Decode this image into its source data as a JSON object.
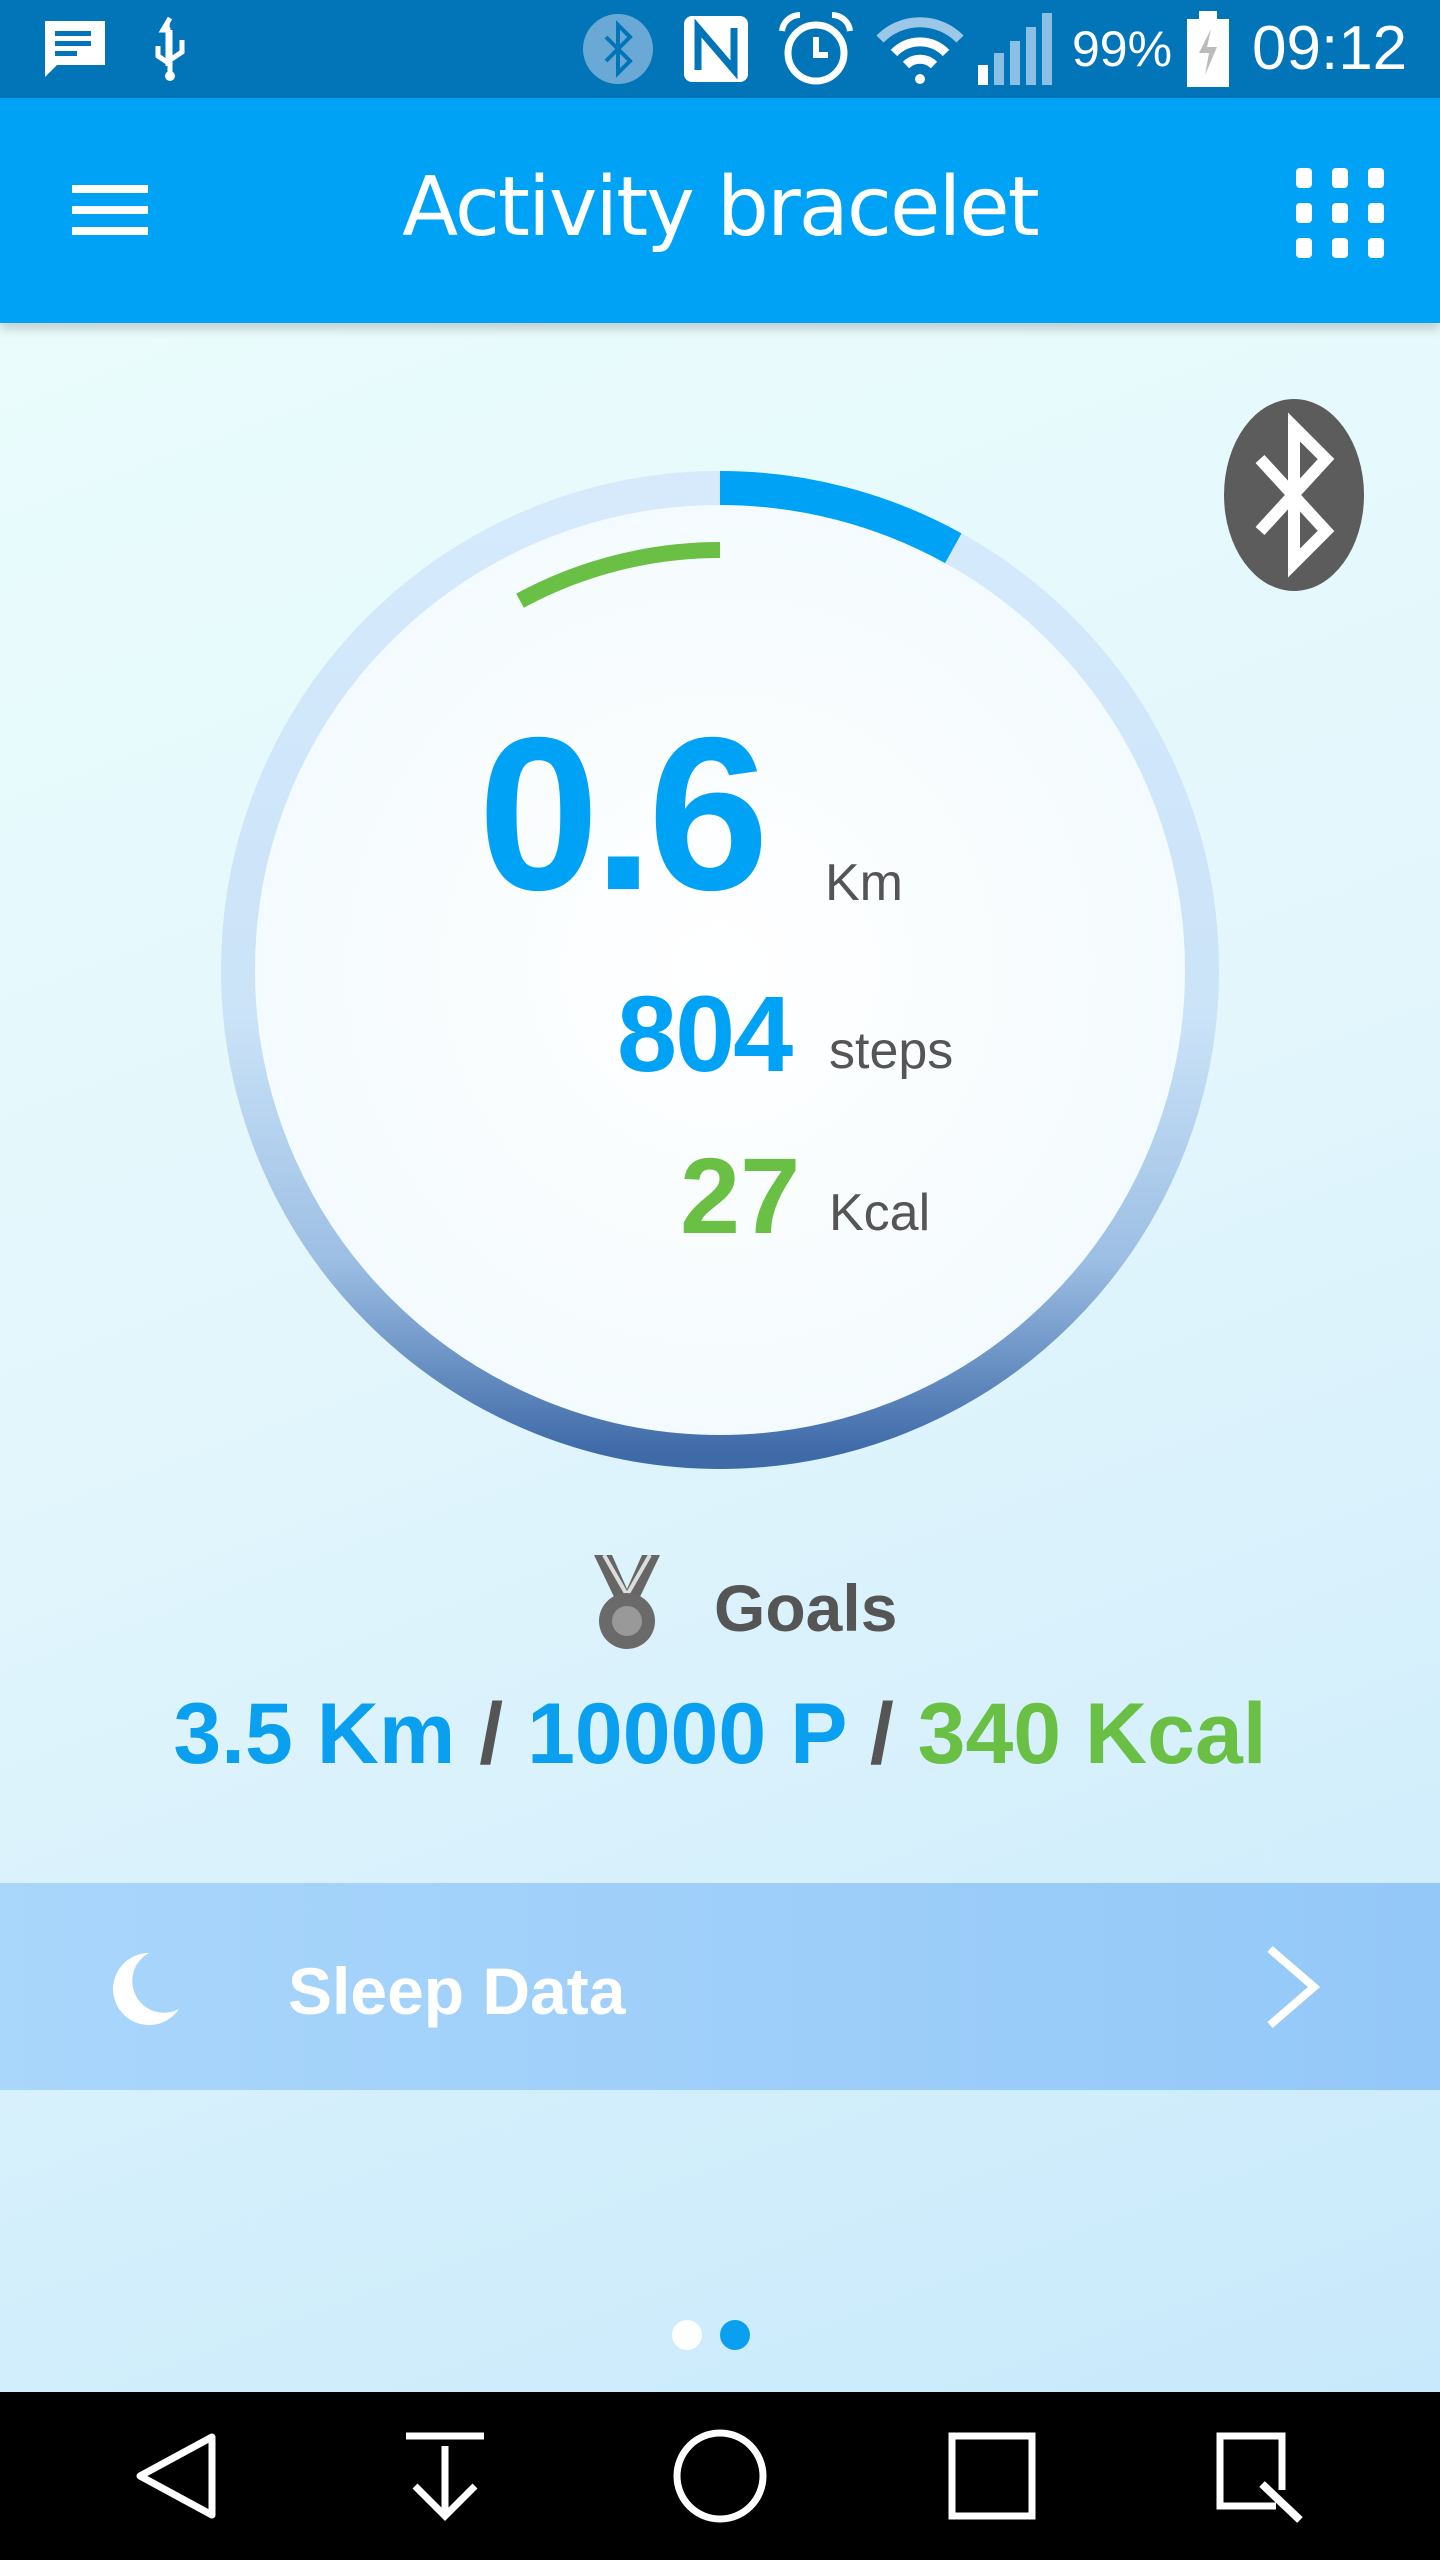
{
  "status_bar": {
    "battery": "99%",
    "time": "09:12",
    "icons": [
      "message-icon",
      "usb-icon",
      "bluetooth-icon",
      "nfc-icon",
      "alarm-icon",
      "wifi-icon",
      "signal-icon",
      "battery-charging-icon"
    ]
  },
  "app_bar": {
    "title": "Activity bracelet",
    "menu_icon": "hamburger-menu-icon",
    "apps_icon": "grid-apps-icon"
  },
  "activity": {
    "distance_value": "0.6",
    "distance_unit": "Km",
    "steps_value": "804",
    "steps_unit": "steps",
    "kcal_value": "27",
    "kcal_unit": "Kcal",
    "steps_progress": 0.0804,
    "kcal_progress": 0.079
  },
  "goals": {
    "title": "Goals",
    "distance": "3.5 Km",
    "steps": "10000 P",
    "kcal": "340 Kcal",
    "separator": "/"
  },
  "sleep": {
    "label": "Sleep Data"
  },
  "pager": {
    "pages": 2,
    "current": 2
  },
  "colors": {
    "primary": "#00a2f5",
    "status_bar": "#0274b8",
    "green": "#6abf45",
    "text_gray": "#555555"
  }
}
